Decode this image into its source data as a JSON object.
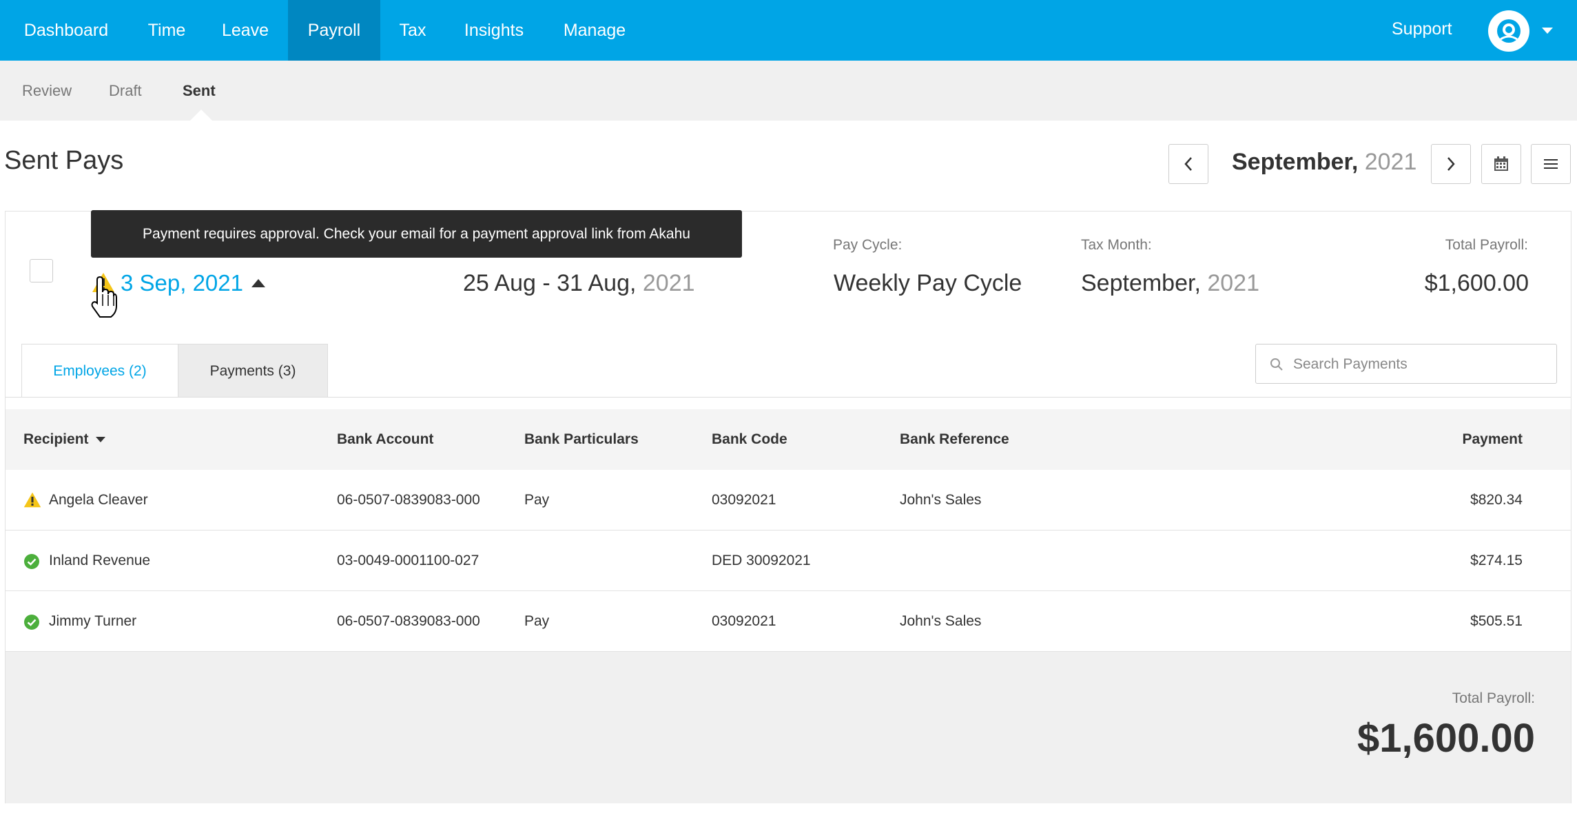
{
  "nav": {
    "items": [
      {
        "label": "Dashboard"
      },
      {
        "label": "Time"
      },
      {
        "label": "Leave"
      },
      {
        "label": "Payroll"
      },
      {
        "label": "Tax"
      },
      {
        "label": "Insights"
      },
      {
        "label": "Manage"
      }
    ],
    "active": "Payroll",
    "support_label": "Support"
  },
  "subnav": {
    "items": [
      {
        "label": "Review"
      },
      {
        "label": "Draft"
      },
      {
        "label": "Sent"
      }
    ],
    "active": "Sent"
  },
  "page": {
    "title": "Sent Pays",
    "period_month": "September,",
    "period_year": "2021"
  },
  "pay_run": {
    "date": "3 Sep, 2021",
    "range_main": "25 Aug - 31 Aug,",
    "range_year": "2021",
    "pay_cycle_label": "Pay Cycle:",
    "pay_cycle_value": "Weekly Pay Cycle",
    "tax_month_label": "Tax Month:",
    "tax_month_value": "September,",
    "tax_month_year": "2021",
    "total_label": "Total Payroll:",
    "total_value": "$1,600.00",
    "tooltip": "Payment requires approval. Check your email for a payment approval link from Akahu"
  },
  "tabs": [
    {
      "label": "Employees (2)"
    },
    {
      "label": "Payments (3)"
    }
  ],
  "search": {
    "placeholder": "Search Payments"
  },
  "table": {
    "columns": [
      "Recipient",
      "Bank Account",
      "Bank Particulars",
      "Bank Code",
      "Bank Reference",
      "Payment"
    ],
    "rows": [
      {
        "status": "warning",
        "recipient": "Angela Cleaver",
        "account": "06-0507-0839083-000",
        "particulars": "Pay",
        "code": "03092021",
        "reference": "John's Sales",
        "payment": "$820.34"
      },
      {
        "status": "ok",
        "recipient": "Inland Revenue",
        "account": "03-0049-0001100-027",
        "particulars": "",
        "code": "DED 30092021",
        "reference": "",
        "payment": "$274.15"
      },
      {
        "status": "ok",
        "recipient": "Jimmy Turner",
        "account": "06-0507-0839083-000",
        "particulars": "Pay",
        "code": "03092021",
        "reference": "John's Sales",
        "payment": "$505.51"
      }
    ]
  },
  "footer": {
    "total_label": "Total Payroll:",
    "total_value": "$1,600.00"
  },
  "colors": {
    "brand": "#00a5e6",
    "nav_active": "#0087c1",
    "warning": "#f5c518",
    "success": "#4caf3c"
  },
  "icons": [
    "user-avatar-icon",
    "chevron-left-icon",
    "chevron-right-icon",
    "calendar-icon",
    "menu-icon",
    "warning-icon",
    "check-circle-icon",
    "search-icon",
    "pointer-cursor-icon"
  ]
}
